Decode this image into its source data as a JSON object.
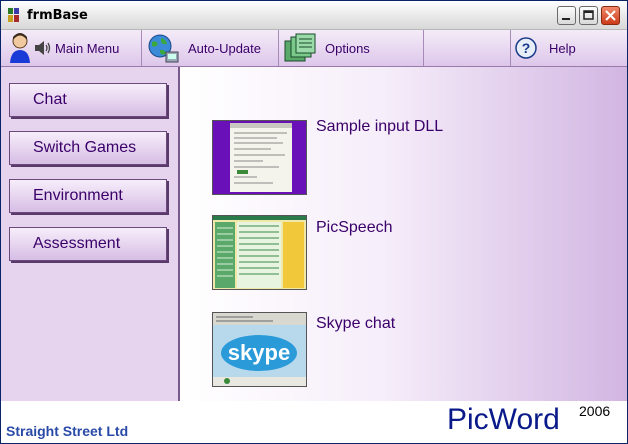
{
  "window": {
    "title": "frmBase"
  },
  "menu": {
    "main_menu": "Main Menu",
    "auto_update": "Auto-Update",
    "options": "Options",
    "help": "Help"
  },
  "sidebar": {
    "items": [
      {
        "label": "Chat"
      },
      {
        "label": "Switch Games"
      },
      {
        "label": "Environment"
      },
      {
        "label": "Assessment"
      }
    ]
  },
  "apps": [
    {
      "label": "Sample input DLL"
    },
    {
      "label": "PicSpeech"
    },
    {
      "label": "Skype chat"
    }
  ],
  "thumb_text": {
    "skype_logo": "skype"
  },
  "footer": {
    "company": "Straight Street Ltd",
    "brand": "PicWord",
    "year": "2006"
  },
  "colors": {
    "menu_text": "#3a006a",
    "sidebar_bg": "#e6d3ee",
    "brand_blue": "#0a1a8a",
    "company_blue": "#2a4aa8"
  }
}
